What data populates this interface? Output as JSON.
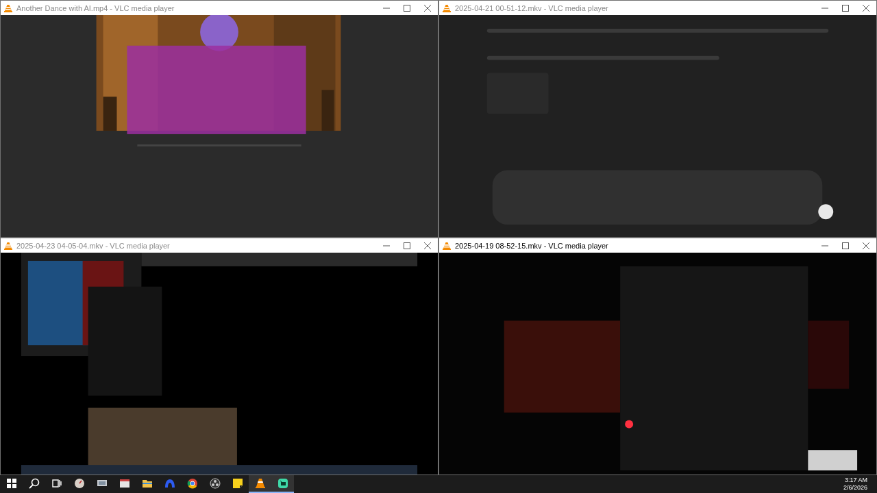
{
  "windows": [
    {
      "title": "Another Dance with AI.mp4 - VLC media player",
      "active": false
    },
    {
      "title": "2025-04-21 00-51-12.mkv - VLC media player",
      "active": false
    },
    {
      "title": "2025-04-23 04-05-04.mkv - VLC media player",
      "active": false
    },
    {
      "title": "2025-04-19 08-52-15.mkv - VLC media player",
      "active": true
    }
  ],
  "taskbar": {
    "apps": [
      {
        "running": false
      },
      {
        "running": false
      },
      {
        "running": false
      },
      {
        "running": false
      },
      {
        "running": false
      },
      {
        "running": false
      },
      {
        "running": false
      },
      {
        "running": false
      },
      {
        "running": true
      },
      {
        "running": true
      }
    ],
    "clock": {
      "time": "3:17 AM",
      "date": "2/6/2026"
    }
  }
}
